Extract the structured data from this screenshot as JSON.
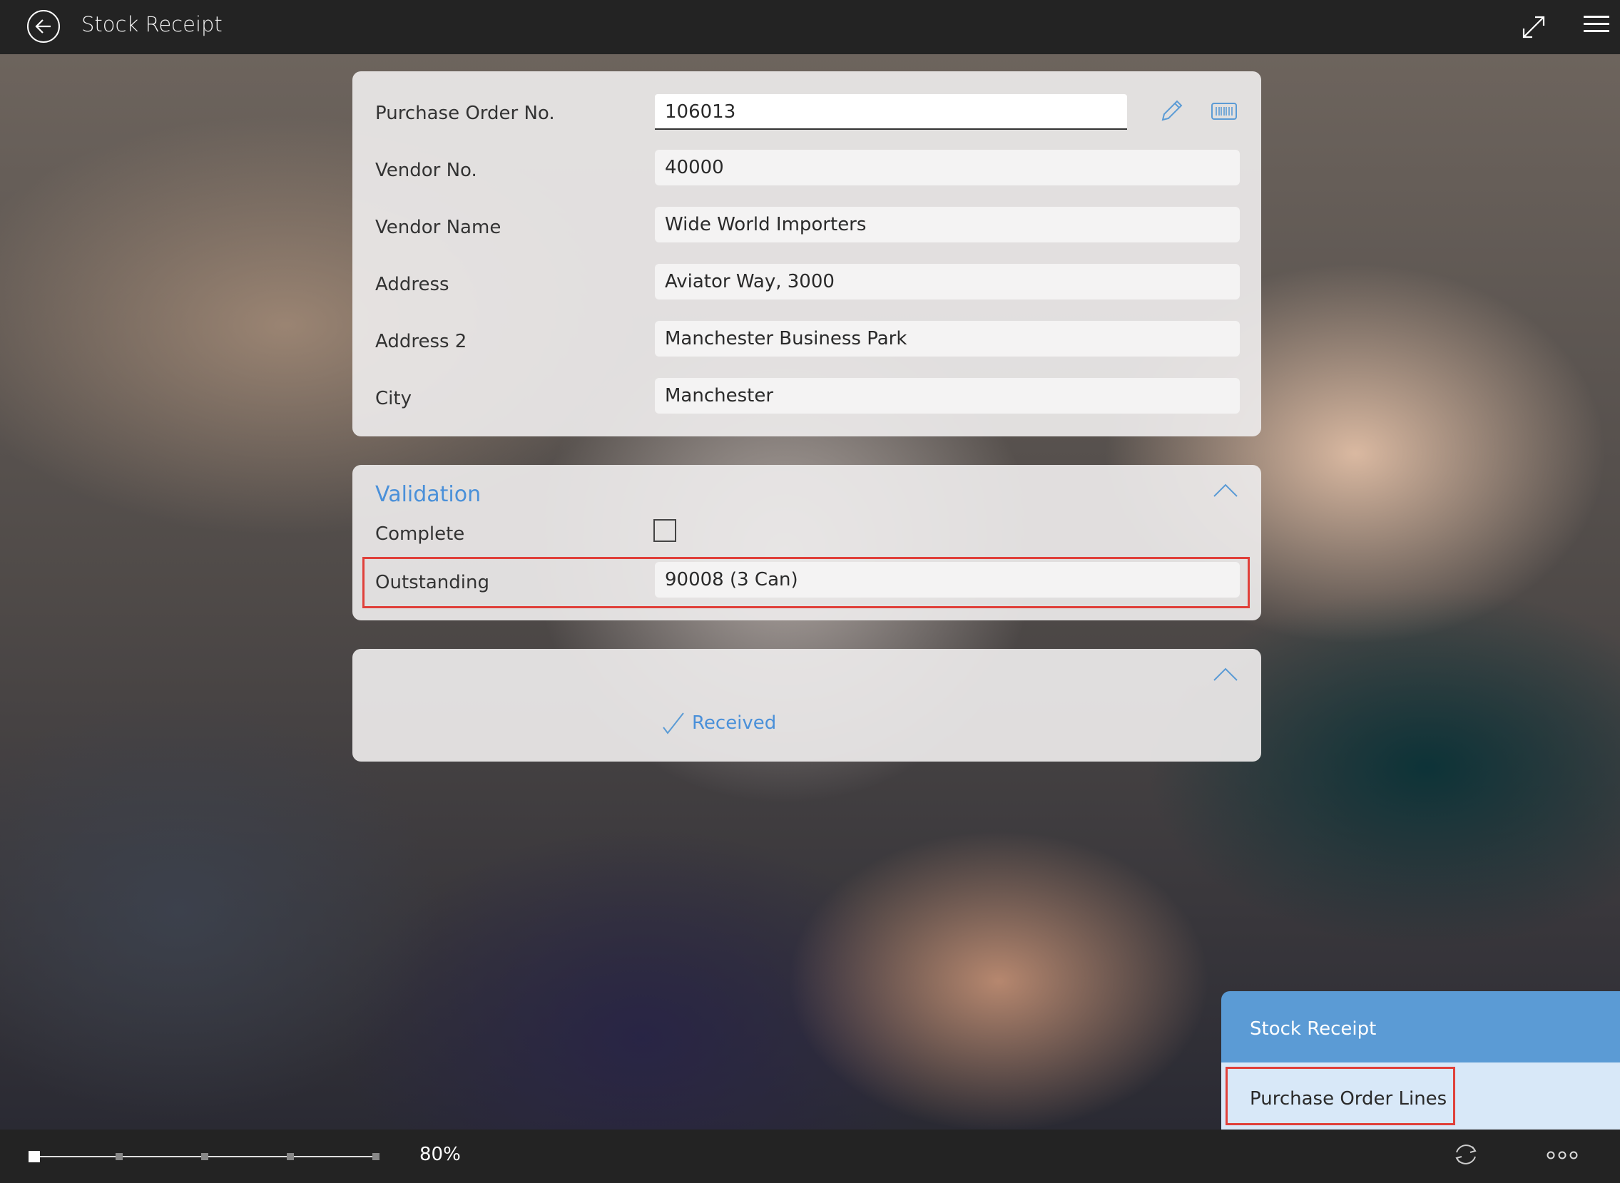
{
  "header": {
    "title": "Stock Receipt"
  },
  "general": {
    "fields": [
      {
        "label": "Purchase Order No.",
        "value": "106013"
      },
      {
        "label": "Vendor No.",
        "value": "40000"
      },
      {
        "label": "Vendor Name",
        "value": "Wide World Importers"
      },
      {
        "label": "Address",
        "value": "Aviator Way, 3000"
      },
      {
        "label": "Address 2",
        "value": "Manchester Business Park"
      },
      {
        "label": "City",
        "value": "Manchester"
      }
    ]
  },
  "validation": {
    "title": "Validation",
    "complete_label": "Complete",
    "complete_checked": false,
    "outstanding_label": "Outstanding",
    "outstanding_value": "90008 (3 Can)"
  },
  "status": {
    "received_label": "Received"
  },
  "nav_panel": {
    "items": [
      {
        "label": "Stock Receipt"
      },
      {
        "label": "Purchase Order Lines"
      }
    ]
  },
  "footer": {
    "zoom": "80%"
  },
  "colors": {
    "accent": "#4a90d9",
    "highlight": "#e0403a",
    "bar": "#232323"
  }
}
